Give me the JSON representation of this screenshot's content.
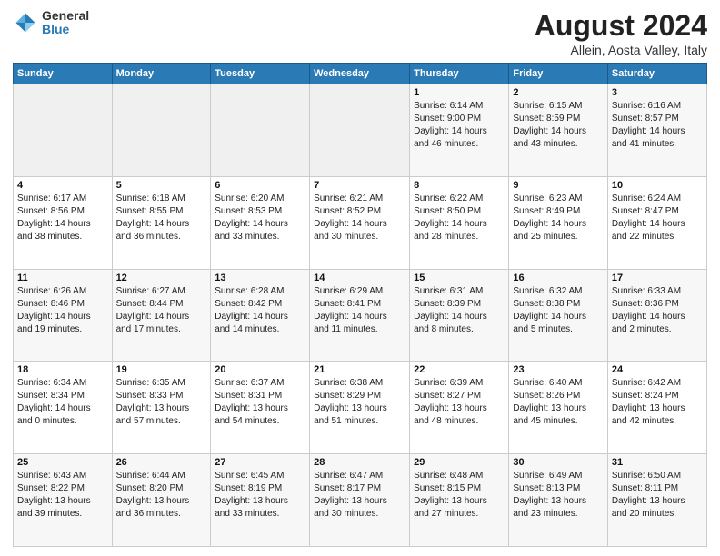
{
  "header": {
    "title": "August 2024",
    "subtitle": "Allein, Aosta Valley, Italy",
    "logo_general": "General",
    "logo_blue": "Blue"
  },
  "days_of_week": [
    "Sunday",
    "Monday",
    "Tuesday",
    "Wednesday",
    "Thursday",
    "Friday",
    "Saturday"
  ],
  "weeks": [
    [
      {
        "day": "",
        "info": ""
      },
      {
        "day": "",
        "info": ""
      },
      {
        "day": "",
        "info": ""
      },
      {
        "day": "",
        "info": ""
      },
      {
        "day": "1",
        "info": "Sunrise: 6:14 AM\nSunset: 9:00 PM\nDaylight: 14 hours\nand 46 minutes."
      },
      {
        "day": "2",
        "info": "Sunrise: 6:15 AM\nSunset: 8:59 PM\nDaylight: 14 hours\nand 43 minutes."
      },
      {
        "day": "3",
        "info": "Sunrise: 6:16 AM\nSunset: 8:57 PM\nDaylight: 14 hours\nand 41 minutes."
      }
    ],
    [
      {
        "day": "4",
        "info": "Sunrise: 6:17 AM\nSunset: 8:56 PM\nDaylight: 14 hours\nand 38 minutes."
      },
      {
        "day": "5",
        "info": "Sunrise: 6:18 AM\nSunset: 8:55 PM\nDaylight: 14 hours\nand 36 minutes."
      },
      {
        "day": "6",
        "info": "Sunrise: 6:20 AM\nSunset: 8:53 PM\nDaylight: 14 hours\nand 33 minutes."
      },
      {
        "day": "7",
        "info": "Sunrise: 6:21 AM\nSunset: 8:52 PM\nDaylight: 14 hours\nand 30 minutes."
      },
      {
        "day": "8",
        "info": "Sunrise: 6:22 AM\nSunset: 8:50 PM\nDaylight: 14 hours\nand 28 minutes."
      },
      {
        "day": "9",
        "info": "Sunrise: 6:23 AM\nSunset: 8:49 PM\nDaylight: 14 hours\nand 25 minutes."
      },
      {
        "day": "10",
        "info": "Sunrise: 6:24 AM\nSunset: 8:47 PM\nDaylight: 14 hours\nand 22 minutes."
      }
    ],
    [
      {
        "day": "11",
        "info": "Sunrise: 6:26 AM\nSunset: 8:46 PM\nDaylight: 14 hours\nand 19 minutes."
      },
      {
        "day": "12",
        "info": "Sunrise: 6:27 AM\nSunset: 8:44 PM\nDaylight: 14 hours\nand 17 minutes."
      },
      {
        "day": "13",
        "info": "Sunrise: 6:28 AM\nSunset: 8:42 PM\nDaylight: 14 hours\nand 14 minutes."
      },
      {
        "day": "14",
        "info": "Sunrise: 6:29 AM\nSunset: 8:41 PM\nDaylight: 14 hours\nand 11 minutes."
      },
      {
        "day": "15",
        "info": "Sunrise: 6:31 AM\nSunset: 8:39 PM\nDaylight: 14 hours\nand 8 minutes."
      },
      {
        "day": "16",
        "info": "Sunrise: 6:32 AM\nSunset: 8:38 PM\nDaylight: 14 hours\nand 5 minutes."
      },
      {
        "day": "17",
        "info": "Sunrise: 6:33 AM\nSunset: 8:36 PM\nDaylight: 14 hours\nand 2 minutes."
      }
    ],
    [
      {
        "day": "18",
        "info": "Sunrise: 6:34 AM\nSunset: 8:34 PM\nDaylight: 14 hours\nand 0 minutes."
      },
      {
        "day": "19",
        "info": "Sunrise: 6:35 AM\nSunset: 8:33 PM\nDaylight: 13 hours\nand 57 minutes."
      },
      {
        "day": "20",
        "info": "Sunrise: 6:37 AM\nSunset: 8:31 PM\nDaylight: 13 hours\nand 54 minutes."
      },
      {
        "day": "21",
        "info": "Sunrise: 6:38 AM\nSunset: 8:29 PM\nDaylight: 13 hours\nand 51 minutes."
      },
      {
        "day": "22",
        "info": "Sunrise: 6:39 AM\nSunset: 8:27 PM\nDaylight: 13 hours\nand 48 minutes."
      },
      {
        "day": "23",
        "info": "Sunrise: 6:40 AM\nSunset: 8:26 PM\nDaylight: 13 hours\nand 45 minutes."
      },
      {
        "day": "24",
        "info": "Sunrise: 6:42 AM\nSunset: 8:24 PM\nDaylight: 13 hours\nand 42 minutes."
      }
    ],
    [
      {
        "day": "25",
        "info": "Sunrise: 6:43 AM\nSunset: 8:22 PM\nDaylight: 13 hours\nand 39 minutes."
      },
      {
        "day": "26",
        "info": "Sunrise: 6:44 AM\nSunset: 8:20 PM\nDaylight: 13 hours\nand 36 minutes."
      },
      {
        "day": "27",
        "info": "Sunrise: 6:45 AM\nSunset: 8:19 PM\nDaylight: 13 hours\nand 33 minutes."
      },
      {
        "day": "28",
        "info": "Sunrise: 6:47 AM\nSunset: 8:17 PM\nDaylight: 13 hours\nand 30 minutes."
      },
      {
        "day": "29",
        "info": "Sunrise: 6:48 AM\nSunset: 8:15 PM\nDaylight: 13 hours\nand 27 minutes."
      },
      {
        "day": "30",
        "info": "Sunrise: 6:49 AM\nSunset: 8:13 PM\nDaylight: 13 hours\nand 23 minutes."
      },
      {
        "day": "31",
        "info": "Sunrise: 6:50 AM\nSunset: 8:11 PM\nDaylight: 13 hours\nand 20 minutes."
      }
    ]
  ]
}
